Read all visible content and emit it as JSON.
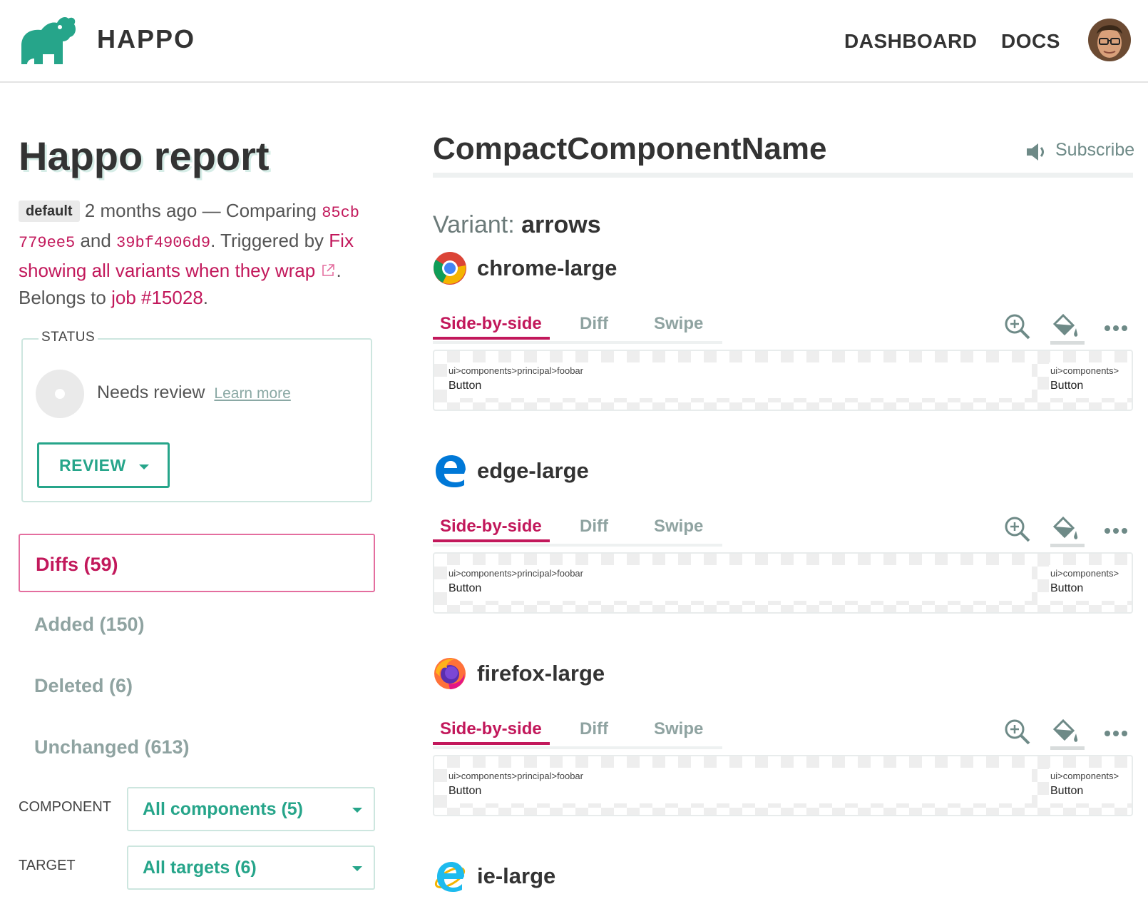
{
  "header": {
    "brand": "HAPPO",
    "nav": {
      "dashboard": "DASHBOARD",
      "docs": "DOCS"
    }
  },
  "report": {
    "title": "Happo report",
    "tag": "default",
    "time": "2 months ago",
    "dash": " — Comparing ",
    "sha_before": "85cb 779ee5",
    "and": " and ",
    "sha_after": "39bf4906d9",
    "triggered": ". Triggered by ",
    "trigger_link": "Fix showing all variants when they wrap",
    "period": ".",
    "belongs": "Belongs to ",
    "job_link": "job #15028",
    "belongs_end": "."
  },
  "status": {
    "legend": "STATUS",
    "text": "Needs review",
    "learn_more": "Learn more",
    "review_button": "REVIEW"
  },
  "filters": {
    "diffs": "Diffs (59)",
    "added": "Added (150)",
    "deleted": "Deleted (6)",
    "unchanged": "Unchanged (613)"
  },
  "selects": {
    "component_label": "COMPONENT",
    "component_value": "All components (5)",
    "target_label": "TARGET",
    "target_value": "All targets (6)"
  },
  "main": {
    "component_title": "CompactComponentName",
    "subscribe": "Subscribe",
    "variant_label": "Variant:",
    "variant_name": "arrows",
    "tabs": {
      "side_by_side": "Side-by-side",
      "diff": "Diff",
      "swipe": "Swipe"
    },
    "targets": [
      {
        "name": "chrome-large",
        "icon": "chrome-icon",
        "left_path": "ui>components>principal>foobar",
        "left_label": "Button",
        "right_path": "ui>components>",
        "right_label": "Button"
      },
      {
        "name": "edge-large",
        "icon": "edge-icon",
        "left_path": "ui>components>principal>foobar",
        "left_label": "Button",
        "right_path": "ui>components>",
        "right_label": "Button"
      },
      {
        "name": "firefox-large",
        "icon": "firefox-icon",
        "left_path": "ui>components>principal>foobar",
        "left_label": "Button",
        "right_path": "ui>components>",
        "right_label": "Button"
      },
      {
        "name": "ie-large",
        "icon": "ie-icon"
      }
    ]
  },
  "colors": {
    "accent_green": "#26a58a",
    "accent_pink": "#c2185b",
    "muted": "#8fa3a1"
  }
}
